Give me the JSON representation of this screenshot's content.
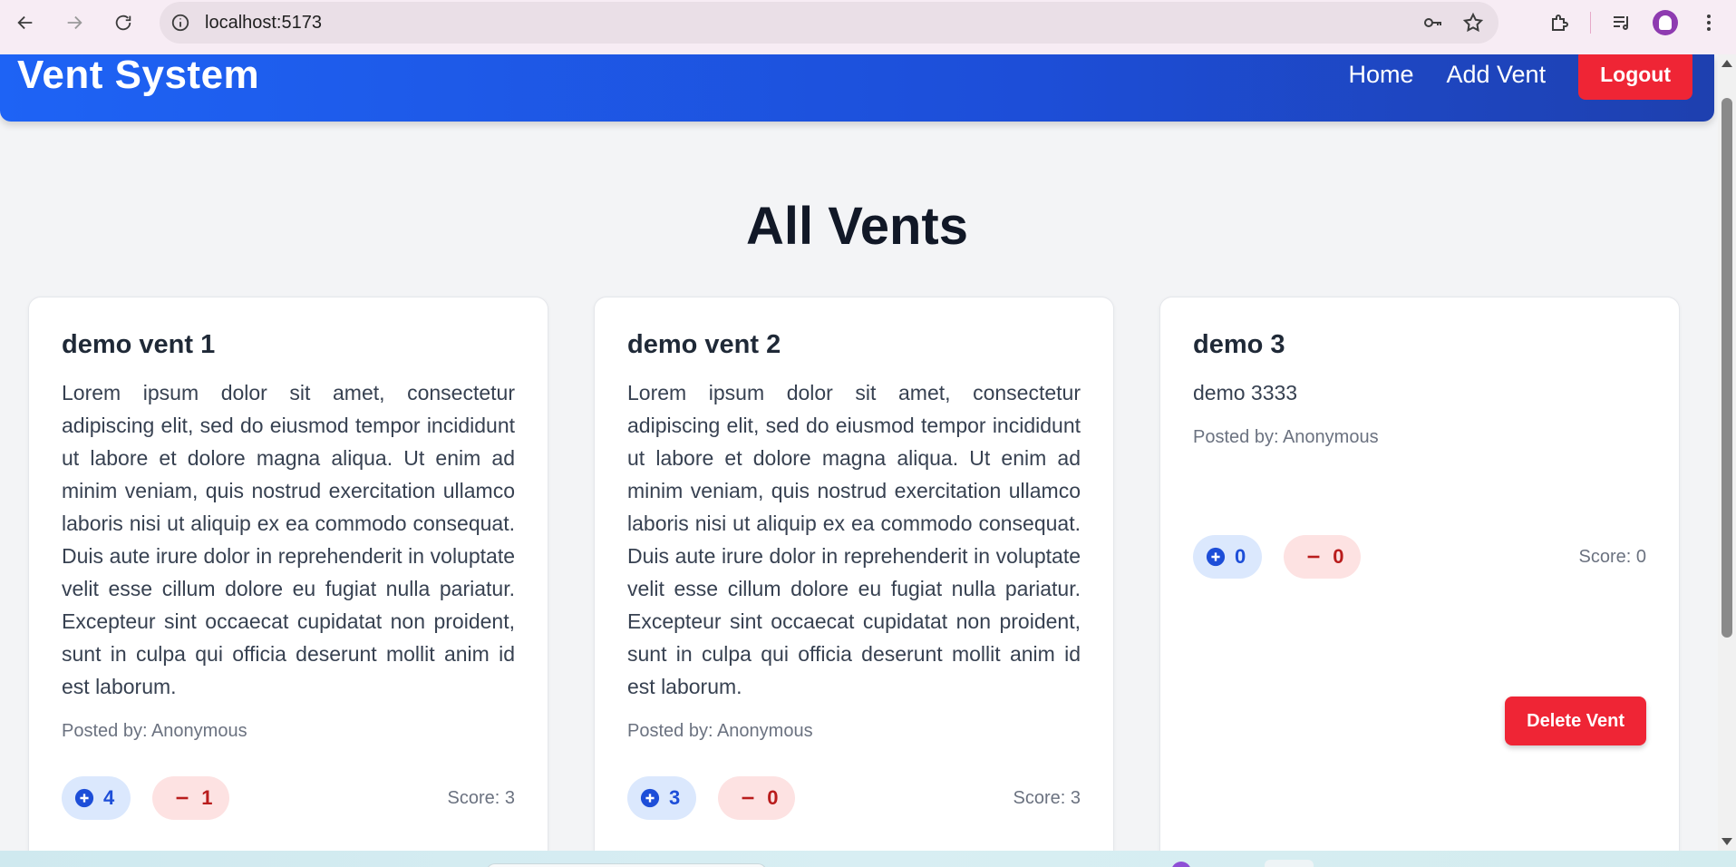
{
  "browser": {
    "url": "localhost:5173",
    "icons": [
      "back-icon",
      "forward-icon",
      "reload-icon",
      "site-info-icon",
      "password-key-icon",
      "bookmark-star-icon",
      "extensions-icon",
      "media-controls-icon",
      "profile-avatar",
      "more-menu-icon"
    ]
  },
  "header": {
    "brand": "Vent System",
    "nav": {
      "home": "Home",
      "add_vent": "Add Vent",
      "logout": "Logout"
    },
    "colors": {
      "gradient_start": "#1e63f5",
      "gradient_end": "#1e40af",
      "logout_bg": "#ef2535"
    }
  },
  "page": {
    "title": "All Vents"
  },
  "vents": [
    {
      "title": "demo vent 1",
      "body": "Lorem ipsum dolor sit amet, consectetur adipiscing elit, sed do eiusmod tempor incididunt ut labore et dolore magna aliqua. Ut enim ad minim veniam, quis nostrud exercitation ullamco laboris nisi ut aliquip ex ea commodo consequat. Duis aute irure dolor in reprehenderit in voluptate velit esse cillum dolore eu fugiat nulla pariatur. Excepteur sint occaecat cupidatat non proident, sunt in culpa qui officia deserunt mollit anim id est laborum.",
      "posted_by": "Posted by: Anonymous",
      "upvotes": "4",
      "downvotes": "1",
      "score": "Score: 3"
    },
    {
      "title": "demo vent 2",
      "body": "Lorem ipsum dolor sit amet, consectetur adipiscing elit, sed do eiusmod tempor incididunt ut labore et dolore magna aliqua. Ut enim ad minim veniam, quis nostrud exercitation ullamco laboris nisi ut aliquip ex ea commodo consequat. Duis aute irure dolor in reprehenderit in voluptate velit esse cillum dolore eu fugiat nulla pariatur. Excepteur sint occaecat cupidatat non proident, sunt in culpa qui officia deserunt mollit anim id est laborum.",
      "posted_by": "Posted by: Anonymous",
      "upvotes": "3",
      "downvotes": "0",
      "score": "Score: 3"
    },
    {
      "title": "demo 3",
      "body": "demo 3333",
      "posted_by": "Posted by: Anonymous",
      "upvotes": "0",
      "downvotes": "0",
      "score": "Score: 0",
      "delete_label": "Delete Vent"
    }
  ]
}
